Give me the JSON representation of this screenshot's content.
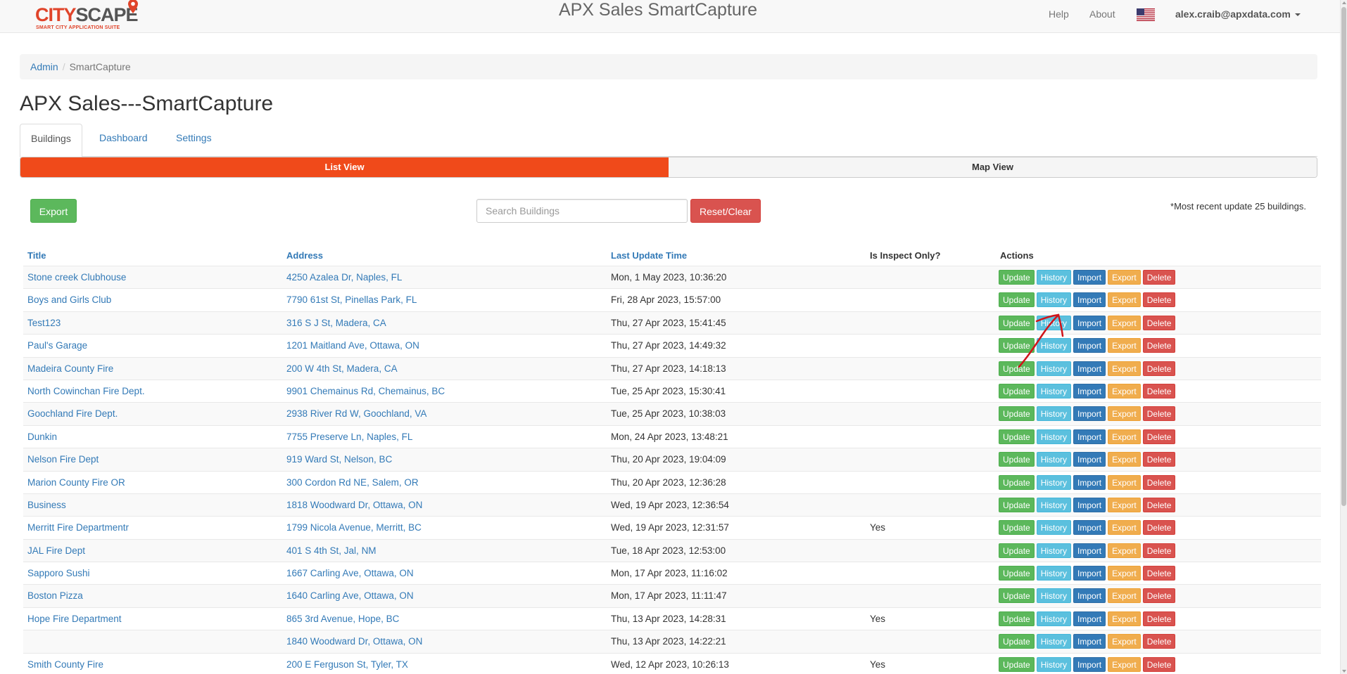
{
  "navbar": {
    "logo": {
      "main_red": "CITY",
      "main_grey": "SCAPE",
      "tagline": "SMART CITY APPLICATION SUITE"
    },
    "title": "APX Sales SmartCapture",
    "links": {
      "help": "Help",
      "about": "About"
    },
    "flag_icon": "us-flag-icon",
    "user": "alex.craib@apxdata.com"
  },
  "breadcrumb": {
    "admin": "Admin",
    "current": "SmartCapture"
  },
  "page_title": "APX Sales---SmartCapture",
  "tabs": [
    {
      "label": "Buildings",
      "active": true
    },
    {
      "label": "Dashboard",
      "active": false
    },
    {
      "label": "Settings",
      "active": false
    }
  ],
  "view_toggle": {
    "list": "List View",
    "map": "Map View",
    "active_color": "#f04a1a"
  },
  "controls": {
    "export_label": "Export",
    "search_placeholder": "Search Buildings",
    "reset_label": "Reset/Clear",
    "recent_note": "*Most recent update 25 buildings."
  },
  "table": {
    "headers": {
      "title": "Title",
      "address": "Address",
      "last_update": "Last Update Time",
      "inspect_only": "Is Inspect Only?",
      "actions": "Actions"
    },
    "action_labels": {
      "update": "Update",
      "history": "History",
      "import": "Import",
      "export": "Export",
      "delete": "Delete"
    },
    "rows": [
      {
        "title": "Stone creek Clubhouse",
        "address": "4250 Azalea Dr, Naples, FL",
        "updated": "Mon, 1 May 2023, 10:36:20",
        "inspect": ""
      },
      {
        "title": "Boys and Girls Club",
        "address": "7790 61st St, Pinellas Park, FL",
        "updated": "Fri, 28 Apr 2023, 15:57:00",
        "inspect": ""
      },
      {
        "title": "Test123",
        "address": "316 S J St, Madera, CA",
        "updated": "Thu, 27 Apr 2023, 15:41:45",
        "inspect": ""
      },
      {
        "title": "Paul's Garage",
        "address": "1201 Maitland Ave, Ottawa, ON",
        "updated": "Thu, 27 Apr 2023, 14:49:32",
        "inspect": ""
      },
      {
        "title": "Madeira County Fire",
        "address": "200 W 4th St, Madera, CA",
        "updated": "Thu, 27 Apr 2023, 14:18:13",
        "inspect": ""
      },
      {
        "title": "North Cowinchan Fire Dept.",
        "address": "9901 Chemainus Rd, Chemainus, BC",
        "updated": "Tue, 25 Apr 2023, 15:30:41",
        "inspect": ""
      },
      {
        "title": "Goochland Fire Dept.",
        "address": "2938 River Rd W, Goochland, VA",
        "updated": "Tue, 25 Apr 2023, 10:38:03",
        "inspect": ""
      },
      {
        "title": "Dunkin",
        "address": "7755 Preserve Ln, Naples, FL",
        "updated": "Mon, 24 Apr 2023, 13:48:21",
        "inspect": ""
      },
      {
        "title": "Nelson Fire Dept",
        "address": "919 Ward St, Nelson, BC",
        "updated": "Thu, 20 Apr 2023, 19:04:09",
        "inspect": ""
      },
      {
        "title": "Marion County Fire OR",
        "address": "300 Cordon Rd NE, Salem, OR",
        "updated": "Thu, 20 Apr 2023, 12:36:28",
        "inspect": ""
      },
      {
        "title": "Business",
        "address": "1818 Woodward Dr, Ottawa, ON",
        "updated": "Wed, 19 Apr 2023, 12:36:54",
        "inspect": ""
      },
      {
        "title": "Merritt Fire Departmentr",
        "address": "1799 Nicola Avenue, Merritt, BC",
        "updated": "Wed, 19 Apr 2023, 12:31:57",
        "inspect": "Yes"
      },
      {
        "title": "JAL Fire Dept",
        "address": "401 S 4th St, Jal, NM",
        "updated": "Tue, 18 Apr 2023, 12:53:00",
        "inspect": ""
      },
      {
        "title": "Sapporo Sushi",
        "address": "1667 Carling Ave, Ottawa, ON",
        "updated": "Mon, 17 Apr 2023, 11:16:02",
        "inspect": ""
      },
      {
        "title": "Boston Pizza",
        "address": "1640 Carling Ave, Ottawa, ON",
        "updated": "Mon, 17 Apr 2023, 11:11:47",
        "inspect": ""
      },
      {
        "title": "Hope Fire Department",
        "address": "865 3rd Avenue, Hope, BC",
        "updated": "Thu, 13 Apr 2023, 14:28:31",
        "inspect": "Yes"
      },
      {
        "title": "",
        "address": "1840 Woodward Dr, Ottawa, ON",
        "updated": "Thu, 13 Apr 2023, 14:22:21",
        "inspect": ""
      },
      {
        "title": "Smith County Fire",
        "address": "200 E Ferguson St, Tyler, TX",
        "updated": "Wed, 12 Apr 2023, 10:26:13",
        "inspect": "Yes"
      }
    ]
  }
}
